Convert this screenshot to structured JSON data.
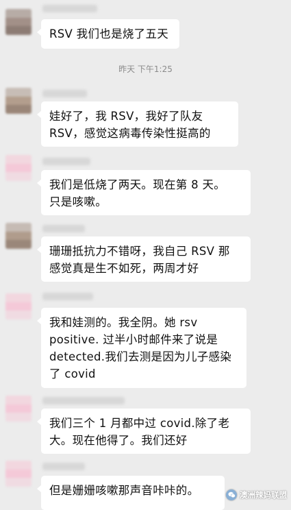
{
  "timestamp": "昨天 下午1:25",
  "messages": [
    {
      "text": "RSV 我们也是烧了五天",
      "avatar": [
        "#b7aca6",
        "#a29088",
        "#8d7c74"
      ]
    },
    {
      "text": "娃好了，我 RSV，我好了队友\nRSV，感觉这病毒传染性挺高的",
      "avatar": [
        "#c7bdb6",
        "#b39e8d",
        "#9a8678"
      ]
    },
    {
      "text": "我们是低烧了两天。现在第 8 天。\n只是咳嗽。",
      "avatar": [
        "#f2d7df",
        "#f4c9d8",
        "#f0dbe2"
      ]
    },
    {
      "text": "珊珊抵抗力不错呀，我自己 RSV 那\n感觉真是生不如死，两周才好",
      "avatar": [
        "#c6bbb4",
        "#b09c8c",
        "#9a877a"
      ]
    },
    {
      "text": "我和娃测的。我全阴。她 rsv\npositive. 过半小时邮件来了说是\ndetected.我们去测是因为儿子感染\n了 covid",
      "avatar": [
        "#f2d7df",
        "#f4c9d8",
        "#f0dbe2"
      ]
    },
    {
      "text": "我们三个 1 月都中过 covid.除了老\n大。现在他得了。我们还好",
      "avatar": [
        "#f2d7df",
        "#f4c9d8",
        "#f0dbe2"
      ]
    },
    {
      "text": "但是姗姗咳嗽那声音咔咔的。",
      "avatar": [
        "#f2d7df",
        "#f4c9d8",
        "#f0dbe2"
      ]
    }
  ],
  "watermark": {
    "text": "澳洲辣妈联盟",
    "icon": "wechat-icon"
  }
}
